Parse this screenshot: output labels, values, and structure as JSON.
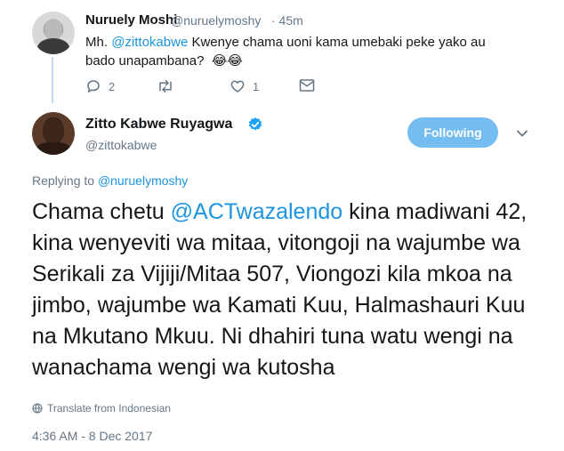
{
  "reply_tweet": {
    "author_name": "Nuruely Moshi",
    "author_handle": "@nuruelymoshy",
    "time": "· 45m",
    "text_prefix": "Mh. ",
    "text_mention": "@zittokabwe",
    "text_body": " Kwenye chama uoni kama umebaki peke yako au bado unapambana?",
    "emoji": "😂😂",
    "actions": {
      "reply_count": "2",
      "retweet_count": "",
      "like_count": "1"
    }
  },
  "main_tweet": {
    "author_name": "Zitto Kabwe Ruyagwa",
    "author_handle": "@zittokabwe",
    "follow_label": "Following",
    "replying_to_prefix": "Replying to ",
    "replying_to_handle": "@nuruelymoshy",
    "text_prefix": "Chama chetu ",
    "text_mention": "@ACTwazalendo",
    "text_body": " kina madiwani 42, kina wenyeviti wa mitaa, vitongoji na wajumbe wa Serikali za Vijiji/Mitaa 507, Viongozi kila mkoa na jimbo, wajumbe wa Kamati Kuu, Halmashauri Kuu na Mkutano Mkuu. Ni dhahiri tuna watu wengi na wanachama wengi wa kutosha",
    "translate_label": "Translate from Indonesian",
    "timestamp": "4:36 AM - 8 Dec 2017"
  },
  "colors": {
    "link": "#1b95e0",
    "muted": "#657786",
    "follow_button": "#74bdf0",
    "thread_line": "#c4d9ee"
  },
  "icons": [
    "reply-icon",
    "retweet-icon",
    "heart-icon",
    "direct-message-icon",
    "verified-badge-icon",
    "chevron-down-icon",
    "globe-icon"
  ]
}
